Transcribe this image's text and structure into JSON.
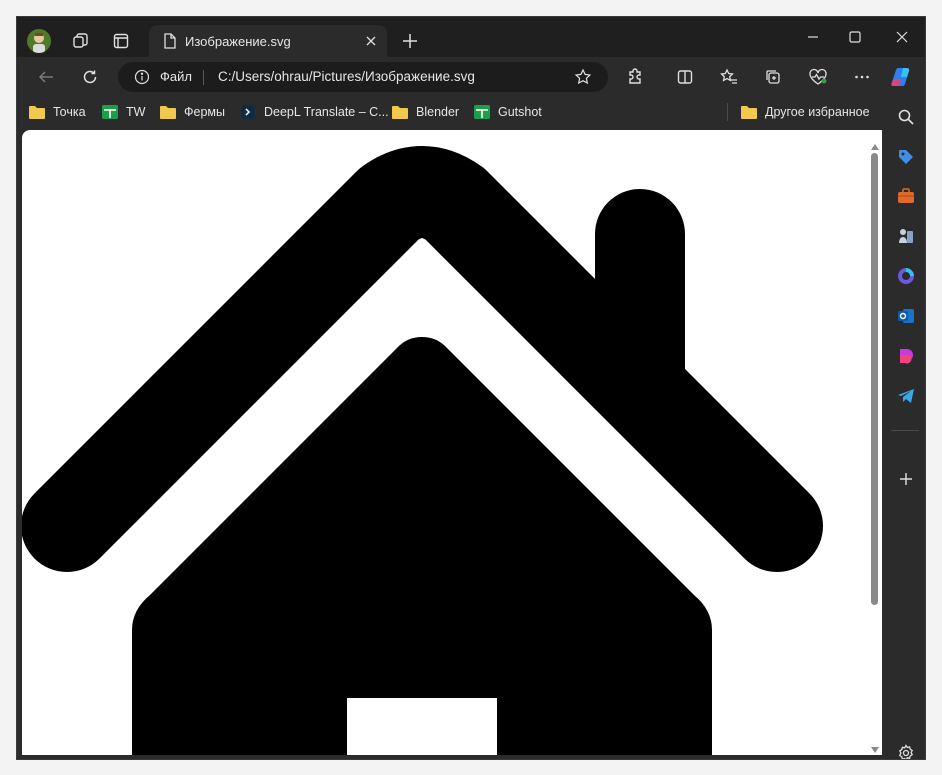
{
  "tab": {
    "title": "Изображение.svg"
  },
  "address_bar": {
    "file_label": "Файл",
    "url": "C:/Users/ohrau/Pictures/Изображение.svg"
  },
  "bookmarks": [
    {
      "label": "Точка",
      "icon": "folder-icon"
    },
    {
      "label": "TW",
      "icon": "sheets-icon"
    },
    {
      "label": "Фермы",
      "icon": "folder-icon"
    },
    {
      "label": "DeepL Translate – C...",
      "icon": "deepl-icon"
    },
    {
      "label": "Blender",
      "icon": "folder-icon"
    },
    {
      "label": "Gutshot",
      "icon": "sheets-icon"
    }
  ],
  "other_favorites": "Другое избранное",
  "image": {
    "subject": "house-icon",
    "fill": "#000000",
    "background": "#ffffff"
  },
  "colors": {
    "folder": "#f2c94c",
    "sheets": "#1e9e4a",
    "chrome_dark": "#1f1f1f",
    "toolbar": "#2b2b2b"
  }
}
